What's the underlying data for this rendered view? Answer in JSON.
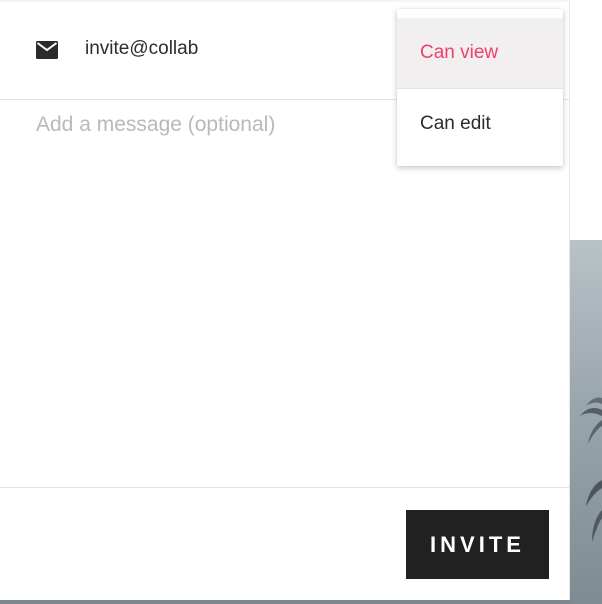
{
  "invite": {
    "email_value": "invite@collab",
    "message_placeholder": "Add a message (optional)",
    "button_label": "INVITE"
  },
  "permission_menu": {
    "options": [
      {
        "label": "Can view",
        "selected": true
      },
      {
        "label": "Can edit",
        "selected": false
      }
    ]
  },
  "icons": {
    "email": "mail-icon"
  },
  "colors": {
    "accent": "#ef3f6a",
    "button_bg": "#212121",
    "selected_option_bg": "#f1efef",
    "placeholder": "#b9b9b9"
  }
}
